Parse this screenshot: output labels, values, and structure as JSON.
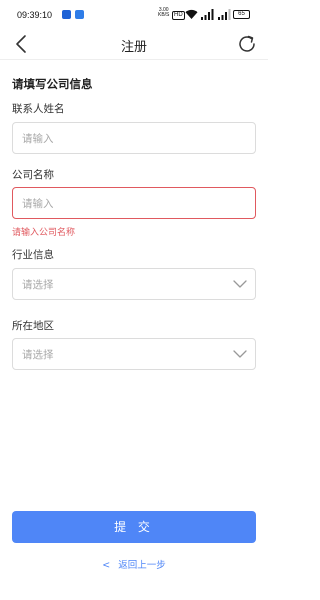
{
  "status": {
    "time": "09:39:10",
    "net_speed": "3.00",
    "net_unit": "KB/S",
    "hd": "HD",
    "battery": "65"
  },
  "nav": {
    "title": "注册"
  },
  "form": {
    "section_title": "请填写公司信息",
    "contact": {
      "label": "联系人姓名",
      "placeholder": "请输入"
    },
    "company": {
      "label": "公司名称",
      "placeholder": "请输入",
      "error": "请输入公司名称"
    },
    "industry": {
      "label": "行业信息",
      "placeholder": "请选择"
    },
    "region": {
      "label": "所在地区",
      "placeholder": "请选择"
    }
  },
  "actions": {
    "submit_label": "提 交",
    "back_arrow": "<",
    "back_label": "返回上一步"
  },
  "colors": {
    "accent": "#4f86f7",
    "error": "#e0595f"
  }
}
